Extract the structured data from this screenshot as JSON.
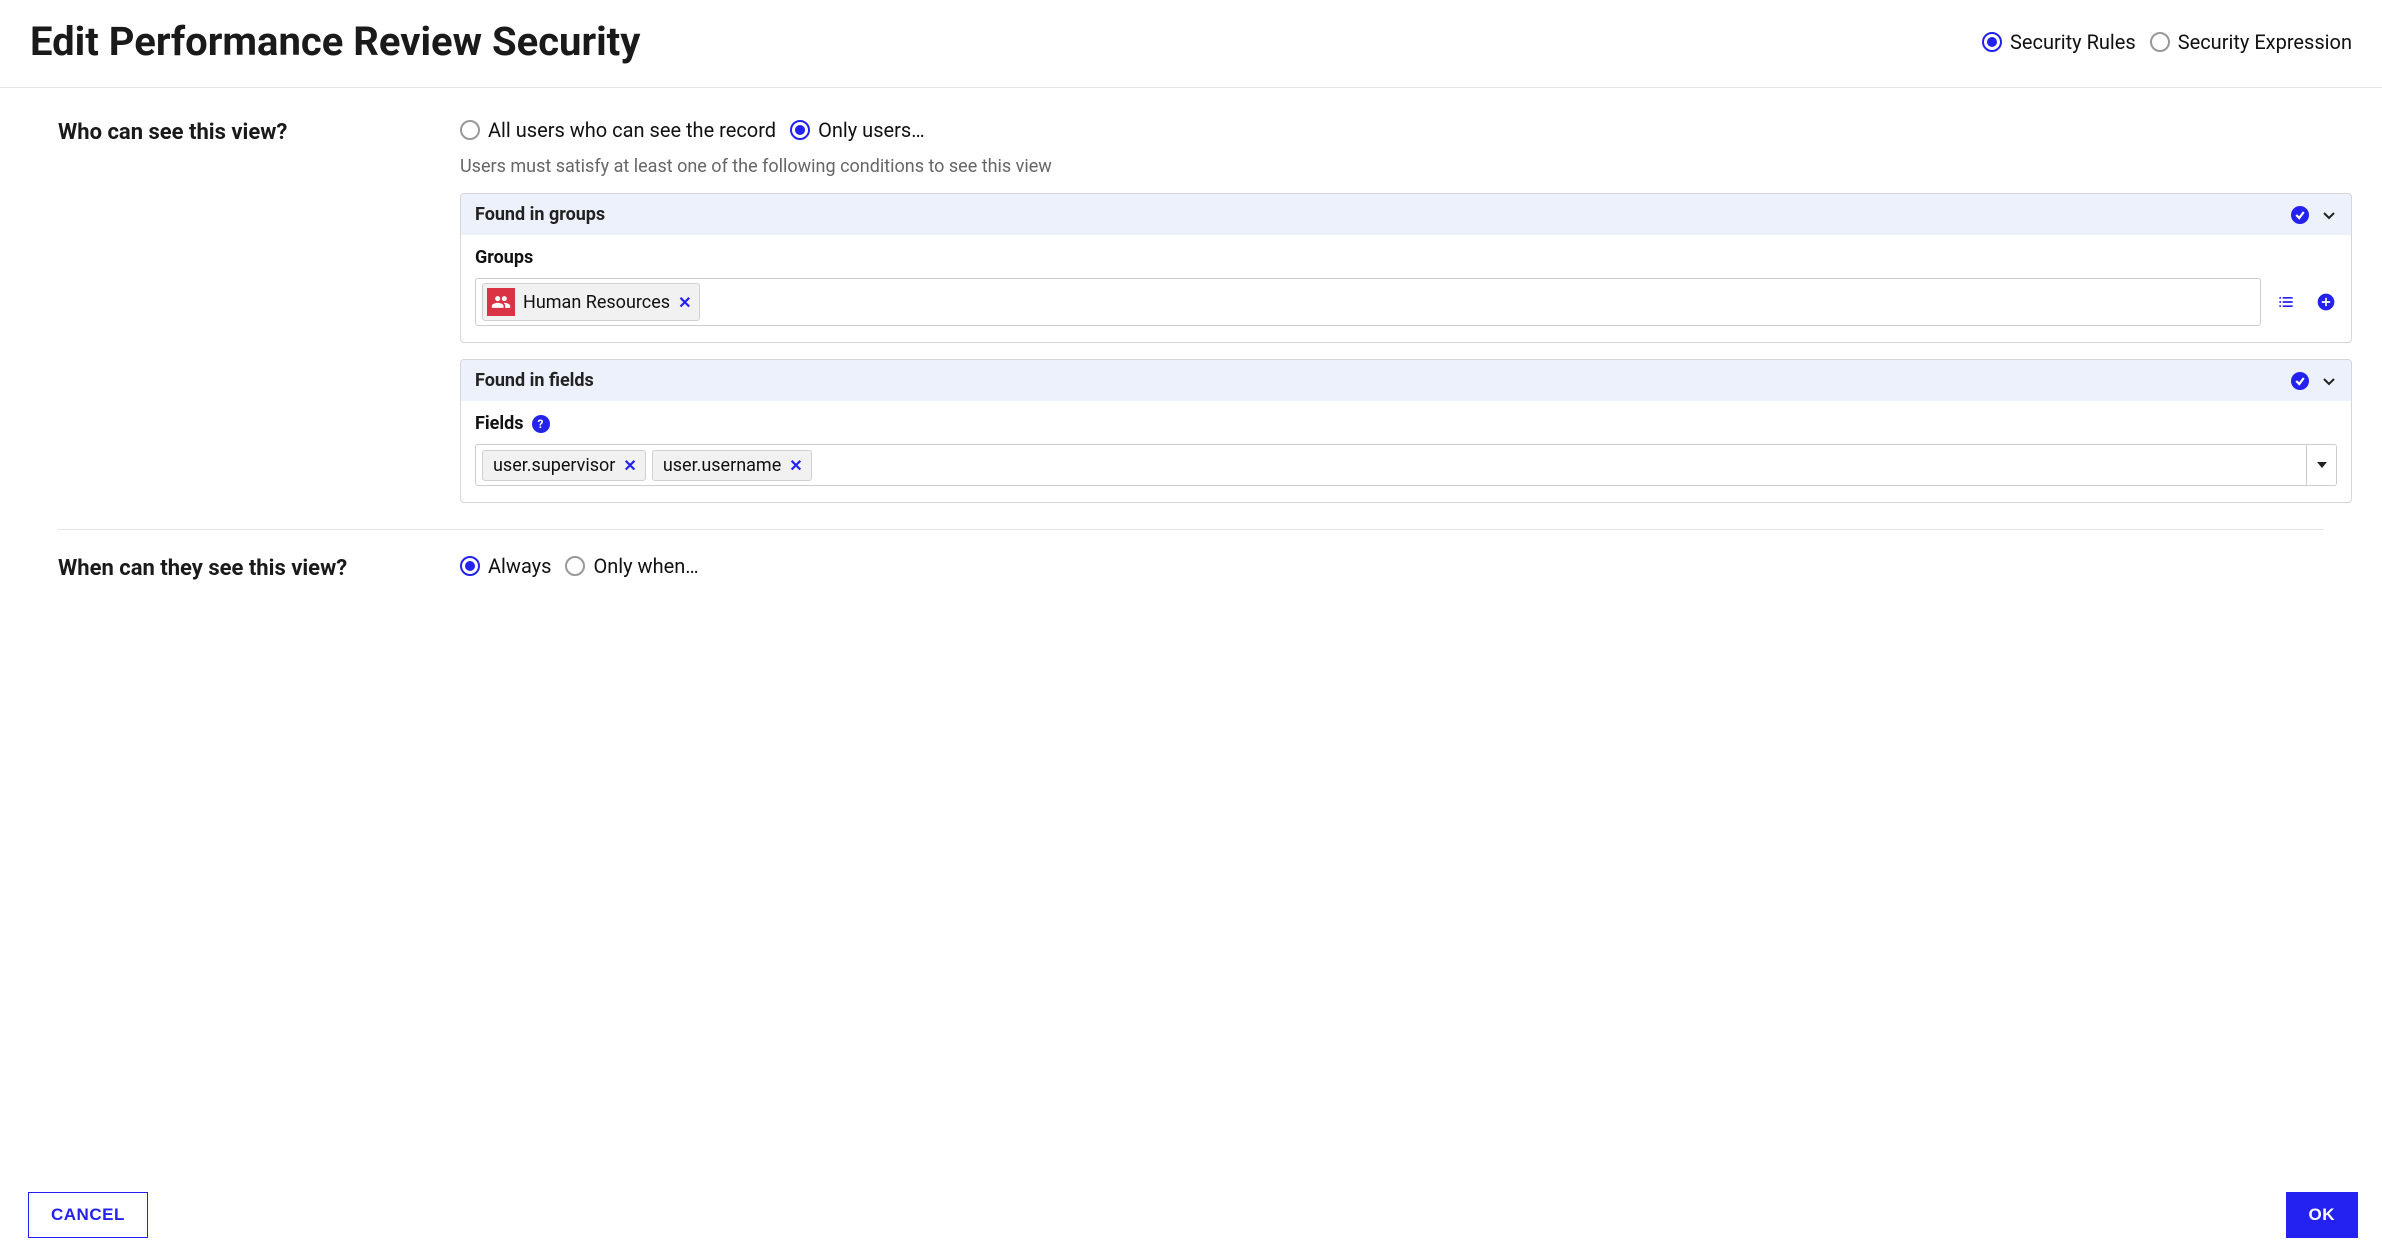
{
  "header": {
    "title": "Edit Performance Review Security",
    "mode_options": {
      "rules": "Security Rules",
      "expression": "Security Expression"
    }
  },
  "who": {
    "question": "Who can see this view?",
    "options": {
      "all": "All users who can see the record",
      "only": "Only users…"
    },
    "hint": "Users must satisfy at least one of the following conditions to see this view",
    "groups_card": {
      "title": "Found in groups",
      "label": "Groups",
      "chips": [
        {
          "label": "Human Resources"
        }
      ]
    },
    "fields_card": {
      "title": "Found in fields",
      "label": "Fields",
      "chips": [
        {
          "label": "user.supervisor"
        },
        {
          "label": "user.username"
        }
      ]
    }
  },
  "when": {
    "question": "When can they see this view?",
    "options": {
      "always": "Always",
      "only": "Only when…"
    }
  },
  "footer": {
    "cancel": "CANCEL",
    "ok": "OK"
  }
}
